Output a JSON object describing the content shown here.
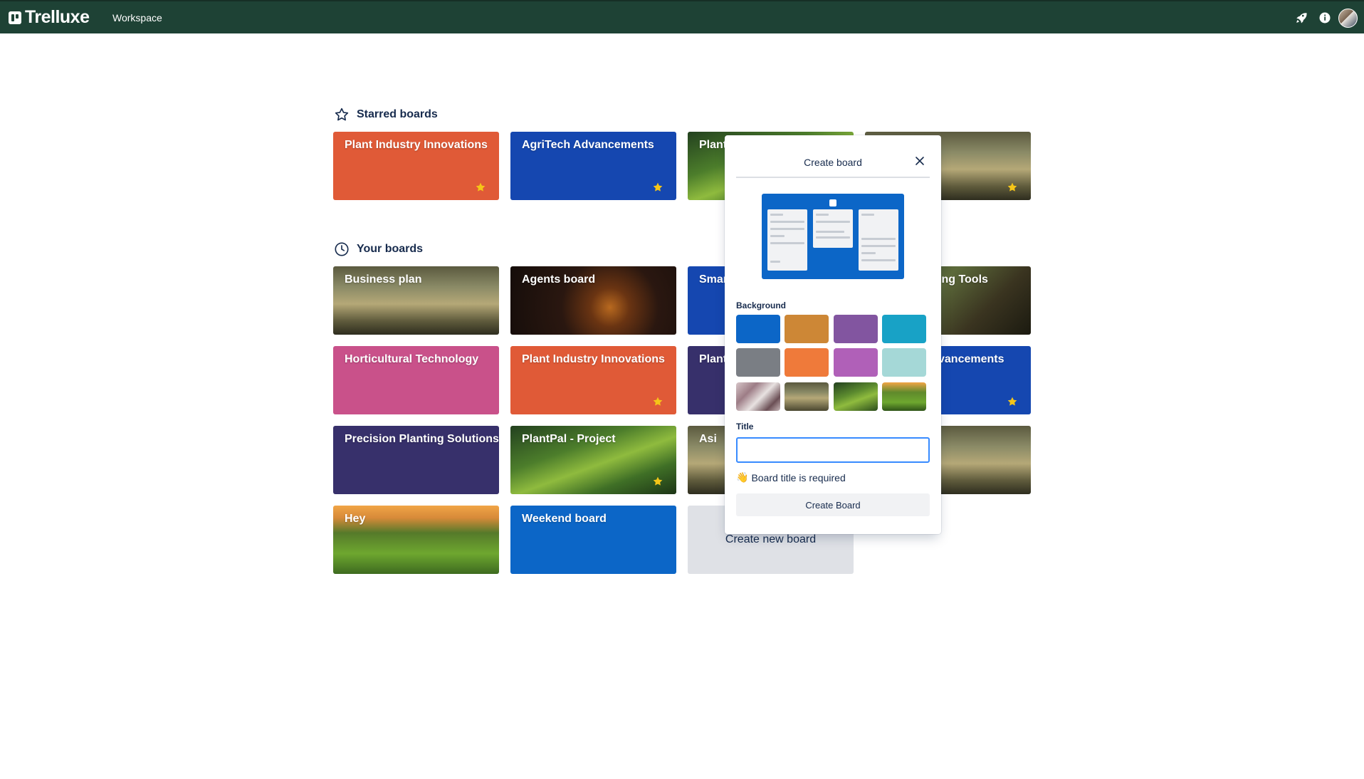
{
  "app": {
    "name": "Trelluxe"
  },
  "header": {
    "workspace_label": "Workspace"
  },
  "starred": {
    "title": "Starred boards",
    "boards": [
      {
        "name": "Plant Industry Innovations",
        "color": "#e05a37",
        "starred": true
      },
      {
        "name": "AgriTech Advancements",
        "color": "#1547b0",
        "starred": true
      },
      {
        "name": "Plant",
        "background": "terrace",
        "starred": false
      },
      {
        "name": "",
        "background": "mountain",
        "starred": true
      }
    ]
  },
  "your_boards": {
    "title": "Your boards",
    "boards": [
      {
        "name": "Business plan",
        "background": "mountain",
        "starred": false
      },
      {
        "name": "Agents board",
        "background": "cave",
        "starred": false
      },
      {
        "name": "Smar",
        "color": "#1547b0",
        "starred": false
      },
      {
        "name": "ing Tools",
        "background": "forest",
        "starred": false
      },
      {
        "name": "Horticultural Technology",
        "color": "#c9518a",
        "starred": false
      },
      {
        "name": "Plant Industry Innovations",
        "color": "#e05a37",
        "starred": true
      },
      {
        "name": "Plant",
        "color": "#37306b",
        "starred": false
      },
      {
        "name": "vancements",
        "color": "#1547b0",
        "starred": true
      },
      {
        "name": "Precision Planting Solutions",
        "color": "#37306b",
        "starred": false
      },
      {
        "name": "PlantPal - Project",
        "background": "terrace",
        "starred": true
      },
      {
        "name": "Asi",
        "background": "mountain",
        "starred": false
      },
      {
        "name": "",
        "background": "mountain",
        "starred": false
      },
      {
        "name": "Hey",
        "background": "valley",
        "starred": false
      },
      {
        "name": "Weekend board",
        "color": "#0c66c7",
        "starred": false
      }
    ],
    "create_new_label": "Create new board"
  },
  "create_board_popover": {
    "title": "Create board",
    "background_label": "Background",
    "swatches": [
      "#0c66c7",
      "#cd8736",
      "#8255a0",
      "#18a2c6",
      "#7a7e84",
      "#ef7a3a",
      "#b060b8",
      "#a5d8d7"
    ],
    "title_label": "Title",
    "title_value": "",
    "error_emoji": "👋",
    "error_text": "Board title is required",
    "submit_label": "Create Board"
  },
  "colors": {
    "header_bg": "#1e4235",
    "star": "#f5c518",
    "input_focus": "#388bff"
  }
}
